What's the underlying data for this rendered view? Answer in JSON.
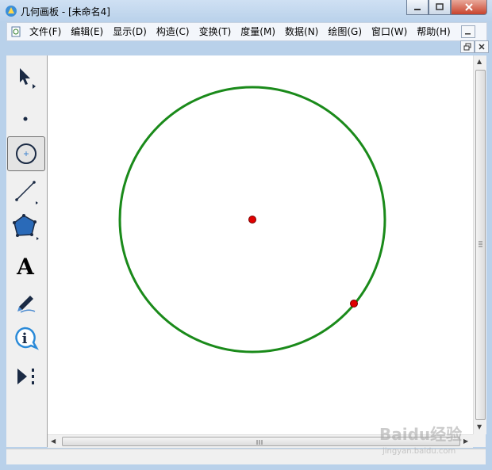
{
  "window": {
    "title": "几何画板 - [未命名4]"
  },
  "menu": {
    "items": [
      {
        "label": "文件(F)"
      },
      {
        "label": "编辑(E)"
      },
      {
        "label": "显示(D)"
      },
      {
        "label": "构造(C)"
      },
      {
        "label": "变换(T)"
      },
      {
        "label": "度量(M)"
      },
      {
        "label": "数据(N)"
      },
      {
        "label": "绘图(G)"
      },
      {
        "label": "窗口(W)"
      },
      {
        "label": "帮助(H)"
      }
    ]
  },
  "toolbox": {
    "tools": [
      {
        "name": "arrow-tool-icon",
        "selected": false
      },
      {
        "name": "point-tool-icon",
        "selected": false
      },
      {
        "name": "compass-tool-icon",
        "selected": true
      },
      {
        "name": "straightedge-tool-icon",
        "selected": false
      },
      {
        "name": "polygon-tool-icon",
        "selected": false
      },
      {
        "name": "text-tool-icon",
        "selected": false,
        "glyph": "A"
      },
      {
        "name": "marker-tool-icon",
        "selected": false
      },
      {
        "name": "information-tool-icon",
        "selected": false,
        "glyph": "i"
      },
      {
        "name": "custom-tool-icon",
        "selected": false
      }
    ]
  },
  "drawing": {
    "circle_color": "#1a8a1a",
    "point_color": "#e00000"
  },
  "watermark": {
    "text": "Baidu经验",
    "sub": "jingyan.baidu.com"
  }
}
